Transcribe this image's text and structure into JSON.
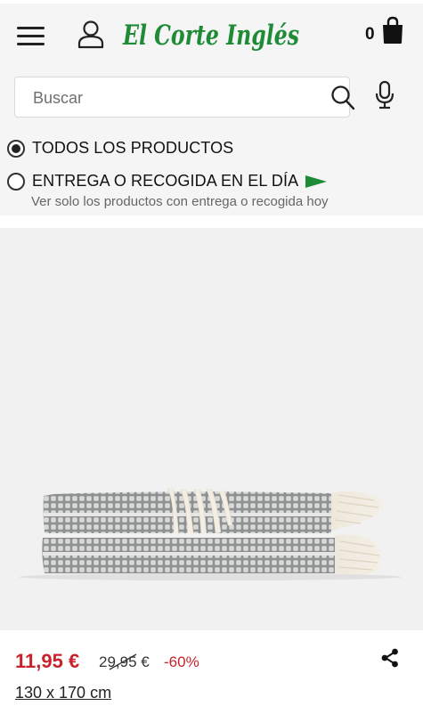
{
  "header": {
    "logo_text": "El Corte Inglés",
    "cart_count": "0"
  },
  "search": {
    "placeholder": "Buscar"
  },
  "filters": [
    {
      "label": "TODOS LOS PRODUCTOS",
      "checked": true
    },
    {
      "label": "ENTREGA O RECOGIDA EN EL DÍA",
      "sublabel": "Ver solo los productos con entrega o recogida hoy",
      "checked": false
    }
  ],
  "product": {
    "price": "11,95 €",
    "old_price": "29,95 €",
    "discount": "-60%",
    "size": "130 x 170 cm"
  },
  "colors": {
    "brand_green": "#1f8b37",
    "price_red": "#c8232c"
  },
  "icons": [
    "menu-icon",
    "user-icon",
    "cart-icon",
    "search-icon",
    "microphone-icon",
    "flag-icon",
    "share-icon"
  ]
}
